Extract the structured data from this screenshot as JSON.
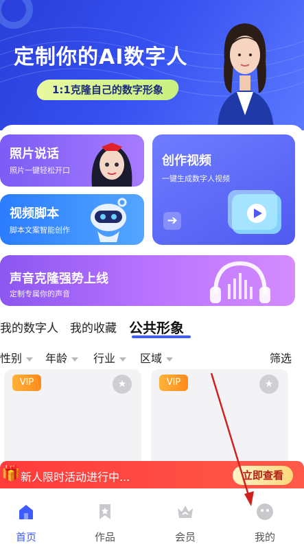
{
  "banner": {
    "title": "定制你的AI数字人",
    "subtitle_pill": "1:1克隆自己的数字形象"
  },
  "feature_cards": {
    "photo_talk": {
      "title": "照片说话",
      "subtitle": "照片一键轻松开口"
    },
    "video_script": {
      "title": "视频脚本",
      "subtitle": "脚本文案智能创作"
    },
    "create_video": {
      "title": "创作视频",
      "subtitle": "一键生成数字人视频"
    },
    "voice_clone": {
      "title": "声音克隆强势上线",
      "subtitle": "定制专属你的声音"
    }
  },
  "tabs": [
    {
      "label": "我的数字人"
    },
    {
      "label": "我的收藏"
    },
    {
      "label": "公共形象",
      "active": true
    }
  ],
  "filters": {
    "gender": "性别",
    "age": "年龄",
    "industry": "行业",
    "region": "区域",
    "filter_label": "筛选"
  },
  "avatar_cards": [
    {
      "badge": "VIP"
    },
    {
      "badge": "VIP"
    }
  ],
  "promo": {
    "text": "新人限时活动进行中...",
    "button": "立即查看"
  },
  "bottom_nav": [
    {
      "label": "首页",
      "icon": "home-icon",
      "active": true
    },
    {
      "label": "作品",
      "icon": "bookmark-icon"
    },
    {
      "label": "会员",
      "icon": "crown-icon"
    },
    {
      "label": "我的",
      "icon": "smile-face-icon"
    }
  ],
  "colors": {
    "accent": "#3e5bff",
    "promo_red": "#ff3b3b",
    "vip_orange": "#ff9a2a",
    "annotation_arrow": "#d0201c"
  }
}
